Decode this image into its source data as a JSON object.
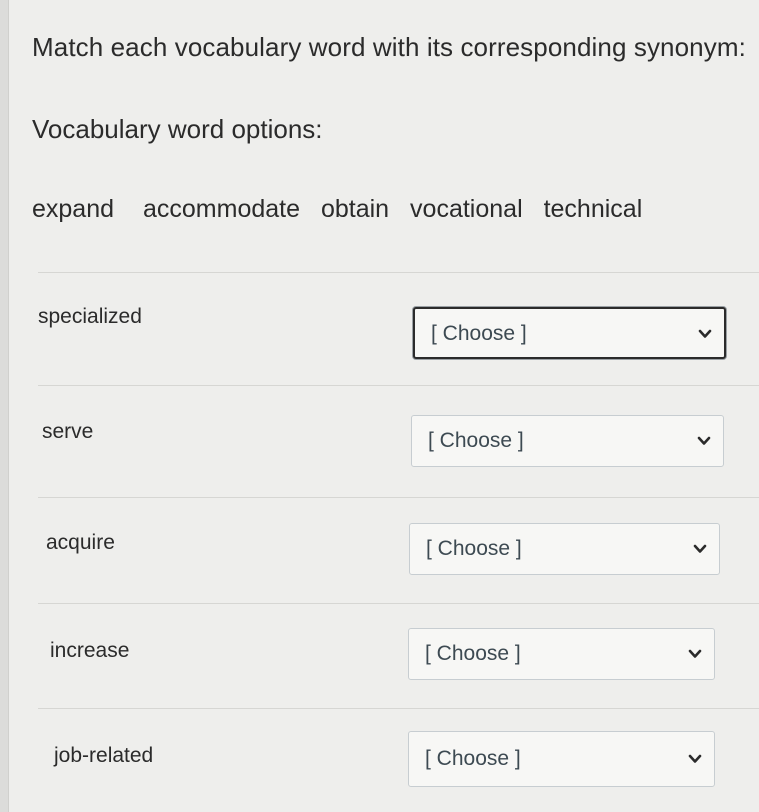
{
  "question": {
    "prompt": "Match each vocabulary word with its corresponding synonym:",
    "options_heading": "Vocabulary word options:",
    "options": [
      "expand",
      "accommodate",
      "obtain",
      "vocational",
      "technical"
    ]
  },
  "matches": [
    {
      "word": "specialized",
      "selected": "[ Choose ]"
    },
    {
      "word": "serve",
      "selected": "[ Choose ]"
    },
    {
      "word": "acquire",
      "selected": "[ Choose ]"
    },
    {
      "word": "increase",
      "selected": "[ Choose ]"
    },
    {
      "word": "job-related",
      "selected": "[ Choose ]"
    }
  ],
  "icons": {
    "dropdown": "chevron-down-icon"
  }
}
